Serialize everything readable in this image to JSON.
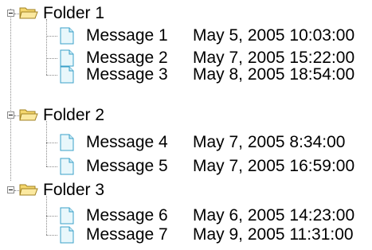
{
  "tree": {
    "folders": [
      {
        "label": "Folder 1",
        "messages": [
          {
            "label": "Message 1",
            "date": "May 5, 2005 10:03:00"
          },
          {
            "label": "Message 2",
            "date": "May 7, 2005 15:22:00"
          },
          {
            "label": "Message 3",
            "date": "May 8, 2005 18:54:00"
          }
        ]
      },
      {
        "label": "Folder 2",
        "messages": [
          {
            "label": "Message 4",
            "date": "May 7, 2005 8:34:00"
          },
          {
            "label": "Message 5",
            "date": "May 7, 2005 16:59:00"
          }
        ]
      },
      {
        "label": "Folder 3",
        "messages": [
          {
            "label": "Message 6",
            "date": "May 6, 2005 14:23:00"
          },
          {
            "label": "Message 7",
            "date": "May 9, 2005 11:31:00"
          }
        ]
      }
    ],
    "colors": {
      "folder_fill": "#f5d76e",
      "folder_stroke": "#a08020",
      "doc_fill": "#e8f7fb",
      "doc_stroke": "#3aa0c8",
      "connector": "#8a8a8a"
    },
    "icons": {
      "expander": "minus-box-icon",
      "folder": "open-folder-icon",
      "message": "document-icon"
    }
  }
}
